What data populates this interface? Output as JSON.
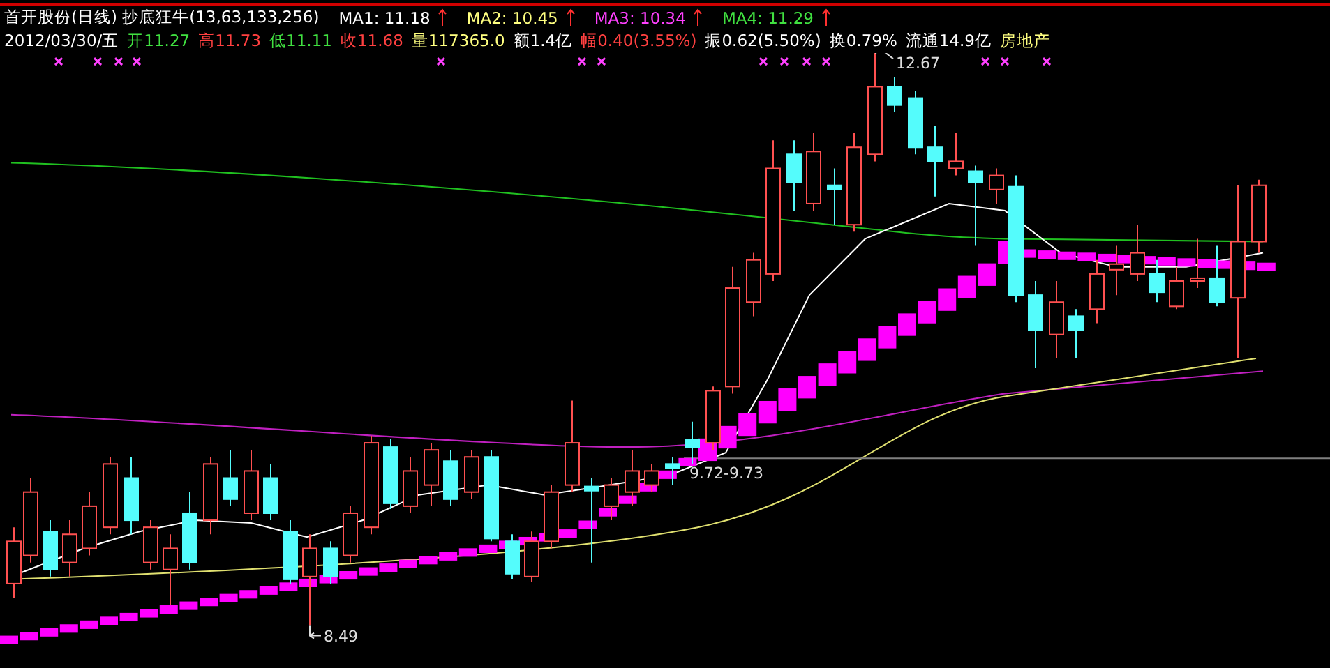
{
  "title_bar": {
    "title": "首开股份(日线) 抄底狂牛(13,63,133,256)",
    "indicators": [
      {
        "label": "MA1: 11.18",
        "color": "#ffffff"
      },
      {
        "label": "MA2: 10.45",
        "color": "#ffff80"
      },
      {
        "label": "MA3: 10.34",
        "color": "#ff40ff"
      },
      {
        "label": "MA4: 11.29",
        "color": "#40e040"
      }
    ]
  },
  "quote_bar": {
    "items": [
      {
        "text": "2012/03/30/五",
        "color": "#ffffff"
      },
      {
        "text": "开11.27",
        "color": "#40e040"
      },
      {
        "text": "高11.73",
        "color": "#ff4040"
      },
      {
        "text": "低11.11",
        "color": "#40e040"
      },
      {
        "text": "收11.68",
        "color": "#ff4040"
      },
      {
        "text": "量117365.0",
        "color": "#ffff80"
      },
      {
        "text": "额1.4亿",
        "color": "#ffffff"
      },
      {
        "text": "幅0.40(3.55%)",
        "color": "#ff4040"
      },
      {
        "text": "振0.62(5.50%)",
        "color": "#ffffff"
      },
      {
        "text": "换0.79%",
        "color": "#ffffff"
      },
      {
        "text": "流通14.9亿",
        "color": "#ffffff"
      },
      {
        "text": "房地产",
        "color": "#ffff80"
      }
    ]
  },
  "chart": {
    "labels": [
      {
        "text": "12.67"
      },
      {
        "text": "9.72-9.73"
      },
      {
        "text": "8.49"
      }
    ]
  }
}
